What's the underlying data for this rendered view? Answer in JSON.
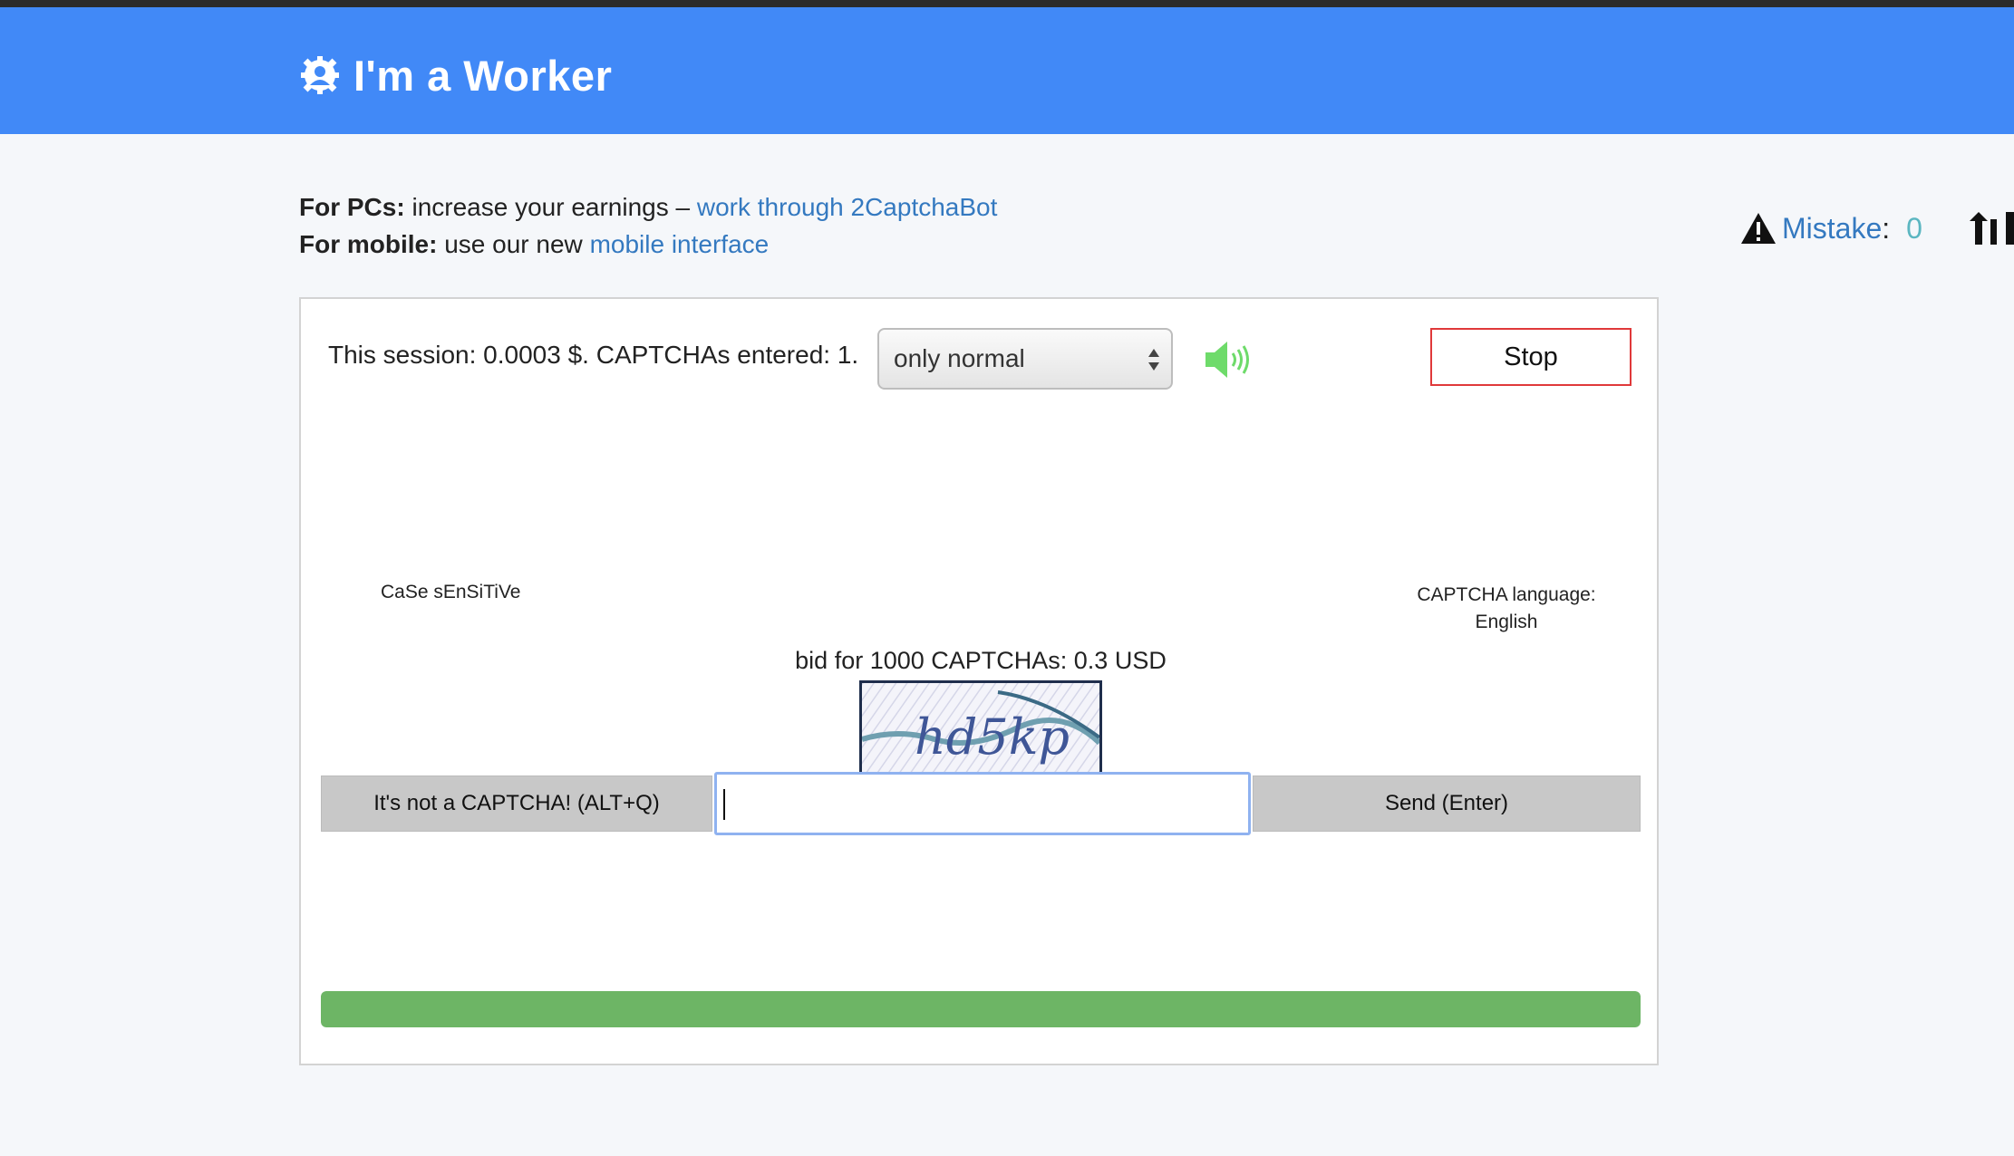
{
  "header": {
    "title": "I'm a Worker",
    "logo_icon": "gear-user-icon",
    "bg_color": "#4189f7"
  },
  "info": {
    "pc_label": "For PCs:",
    "pc_text": " increase your earnings – ",
    "pc_link": "work through 2CaptchaBot",
    "mobile_label": "For mobile:",
    "mobile_text": " use our new ",
    "mobile_link": "mobile interface"
  },
  "stats": {
    "mistake_label": "Mistake",
    "colon": ":",
    "mistake_value": "0",
    "warn_icon": "warning-icon",
    "rank_icon": "upload-arrow-icon"
  },
  "panel": {
    "session_text": "This session: 0.0003 $. CAPTCHAs entered: 1.",
    "mode_select": {
      "selected": "only normal"
    },
    "speaker_icon": "speaker-icon",
    "stop_label": "Stop",
    "case_text": "CaSe sEnSiTiVe",
    "language_label": "CAPTCHA language:",
    "language_value": "English",
    "bid_text": "bid for 1000 CAPTCHAs: 0.3 USD",
    "captcha_image_text": "hd5kp",
    "not_captcha_label": "It's not a CAPTCHA! (ALT+Q)",
    "answer_value": "",
    "send_label": "Send (Enter)",
    "progress": 1.0,
    "progress_color": "#6db565"
  }
}
